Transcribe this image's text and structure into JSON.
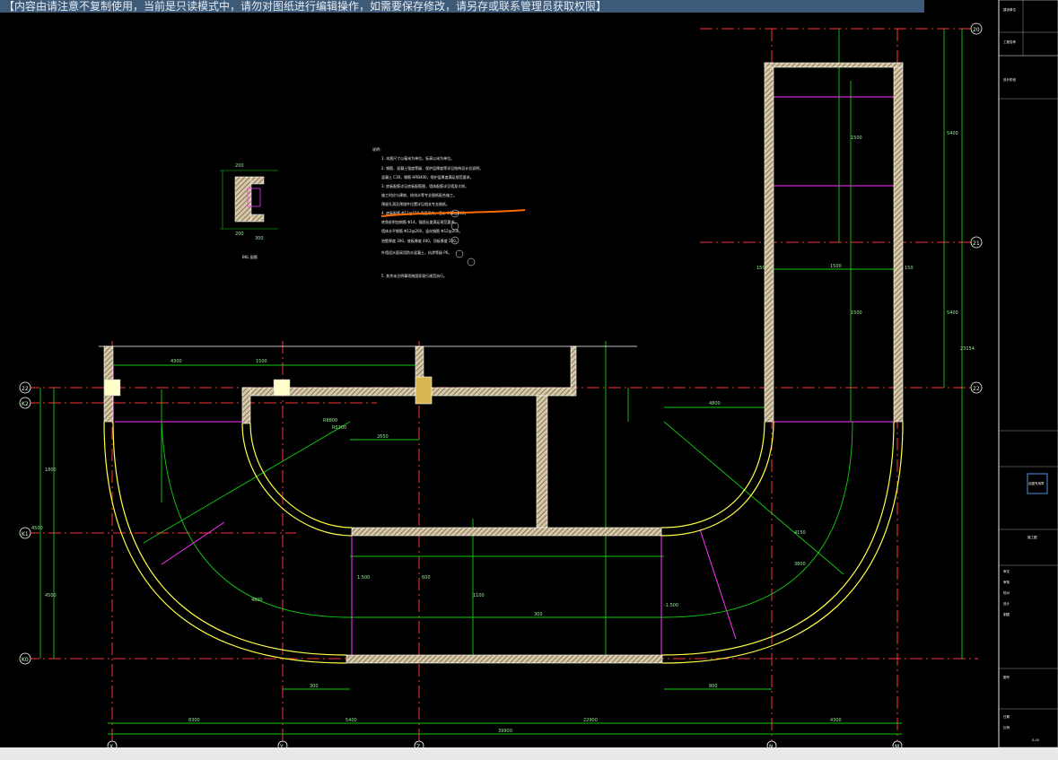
{
  "banner": {
    "text": "【内容由请注意不复制使用，当前是只读模式中，请勿对图纸进行编辑操作，如需要保存修改，请另存或联系管理员获取权限】"
  },
  "section": {
    "title": "BKL 配筋",
    "dims": [
      "200",
      "200",
      "300"
    ]
  },
  "notes": {
    "heading": "说明：",
    "lines": [
      "1. 本图尺寸以毫米为单位，标高以米为单位。",
      "2. 钢筋、混凝土强度等级、保护层厚度等详见结构设计总说明。",
      "   混凝土 C30，钢筋 HRB400，保护层厚度满足规范要求。",
      "3. 底板配筋详见底板配筋图，墙体配筋详见墙身大样。",
      "   施工时应与建筑、给排水等专业图纸配合施工。",
      "   预留孔洞及预埋件位置详见相关专业图纸。",
      "4. 底板配筋 Φ12@150 双层双向，墙体 Φ12@200。",
      "   转角处附加钢筋 Φ14，锚固长度满足规范要求。",
      "   墙体水平钢筋 Φ12@200，竖向钢筋 Φ12@200。",
      "   池壁厚度 300，底板厚度 400，顶板厚度 200。",
      "   外墙迎水面采用防水混凝土，抗渗等级 P6。",
      "5. 其余未注明事项按国家现行规范执行。"
    ]
  },
  "axes": {
    "right": [
      "20",
      "21",
      "22"
    ],
    "left": [
      "22",
      "K2",
      "K1",
      "K0"
    ],
    "bottom": [
      "X",
      "Y",
      "Z",
      "N",
      "M"
    ]
  },
  "dimensions": {
    "top": [
      "4300",
      "1500"
    ],
    "inner": [
      "2650",
      "4800",
      "1500"
    ],
    "bottom_row": [
      "8300",
      "5400",
      "22900",
      "4300"
    ],
    "bottom_total": "39900",
    "bottom_small": [
      "300",
      "800"
    ],
    "right_col": [
      "5400",
      "5400",
      "23154"
    ],
    "right_tower": [
      "1500",
      "1500",
      "150",
      "150"
    ],
    "left_col": [
      "1800",
      "4500",
      "4500"
    ],
    "radial": [
      "R8800",
      "R5300",
      "4150",
      "3800",
      "4800"
    ],
    "misc": [
      "1100",
      "300",
      "1.500",
      "600",
      "-1.500"
    ]
  },
  "title_block": {
    "rows": [
      "建设单位",
      "工程名称",
      "设计阶段",
      "施工图",
      "审定",
      "审核",
      "校对",
      "设计",
      "制图",
      "图号",
      "日期",
      "比例"
    ],
    "stamp": "出图专用章",
    "drawing_no": "S-05"
  },
  "colors": {
    "background": "#000000",
    "wall_fill": "#d8c7a0",
    "wall_hatch": "#555555",
    "yellow": "#ffff44",
    "green": "#11cc11",
    "magenta": "#ff33ff",
    "red": "#ff3333",
    "white": "#ffffff",
    "orange": "#ff6a00",
    "banner": "#3d5a78"
  }
}
